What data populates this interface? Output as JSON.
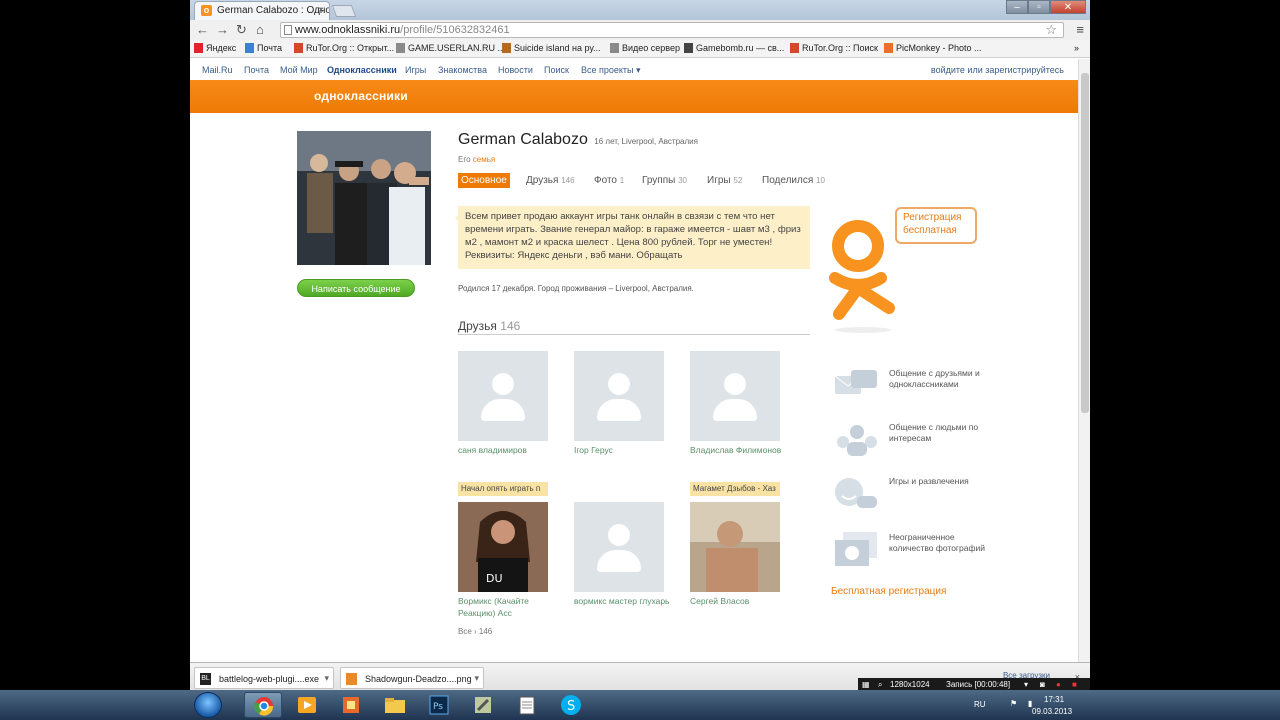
{
  "browser": {
    "tab_title": "German Calabozo : Одно",
    "url_host": "www.odnoklassniki.ru",
    "url_path": "/profile/510632832461",
    "bookmarks": [
      {
        "label": "Яндекс",
        "color": "#e0242b"
      },
      {
        "label": "Почта",
        "color": "#3f7fcf"
      },
      {
        "label": "RuTor.Org :: Открыт...",
        "color": "#d9452a"
      },
      {
        "label": "GAME.USERLAN.RU ...",
        "color": "#8a8a8a"
      },
      {
        "label": "Suicide island на ру...",
        "color": "#b66a1c"
      },
      {
        "label": "Видео сервер",
        "color": "#8a8a8a"
      },
      {
        "label": "Gamebomb.ru — св...",
        "color": "#444444"
      },
      {
        "label": "RuTor.Org :: Поиск",
        "color": "#d9452a"
      },
      {
        "label": "PicMonkey - Photo ...",
        "color": "#e8702a"
      }
    ],
    "bookmarks_more": "»"
  },
  "topnav": {
    "items": [
      "Mail.Ru",
      "Почта",
      "Мой Мир",
      "Одноклассники",
      "Игры",
      "Знакомства",
      "Новости",
      "Поиск",
      "Все проекты ▾"
    ],
    "active_index": 3,
    "login": "войдите или зарегистрируйтесь"
  },
  "site": {
    "logo": "одноклассники",
    "accent": "#ee7a05"
  },
  "profile": {
    "name": "German Calabozo",
    "meta": "16 лет, Liverpool, Австралия",
    "family_prefix": "Его",
    "family_link": "семья",
    "message_button": "Написать сообщение",
    "tabs": [
      {
        "label": "Основное",
        "count": ""
      },
      {
        "label": "Друзья",
        "count": "146"
      },
      {
        "label": "Фото",
        "count": "1"
      },
      {
        "label": "Группы",
        "count": "30"
      },
      {
        "label": "Игры",
        "count": "52"
      },
      {
        "label": "Поделился",
        "count": "10"
      }
    ],
    "status": "Всем привет продаю аккаунт игры танк онлайн в свзязи с тем что нет времени играть. Звание генерал майор: в гараже имеется - шавт м3 , фриз м2 , мамонт м2 и краска шелест . Цена 800 рублей. Торг не уместен! Реквизиты: Яндекс деньги , вэб мани. Обращать",
    "born": "Родился 17 декабря. Город проживания – Liverpool, Австралия."
  },
  "friends": {
    "heading": "Друзья",
    "count": "146",
    "items": [
      {
        "name": "саня владимиров",
        "tag": ""
      },
      {
        "name": "Ігор Герус",
        "tag": ""
      },
      {
        "name": "Владислав Филимонов",
        "tag": ""
      },
      {
        "name": "Вормикс (Качайте Реакцию) Асс",
        "tag": "Начал опять играть п"
      },
      {
        "name": "вормикс мастер глухарь",
        "tag": ""
      },
      {
        "name": "Сергей Власов",
        "tag": "Магамет Дзыбов - Хаз"
      }
    ],
    "all_link": "Все › 146"
  },
  "promo": {
    "bubble": "Регистрация бесплатная",
    "features": [
      {
        "icon": "chat-icon",
        "text": "Общение с друзьями и одноклассниками"
      },
      {
        "icon": "people-icon",
        "text": "Общение с людьми по интересам"
      },
      {
        "icon": "gamepad-icon",
        "text": "Игры и развлечения"
      },
      {
        "icon": "photos-icon",
        "text": "Неограниченное количество фотографий"
      }
    ],
    "free_reg": "Бесплатная регистрация"
  },
  "downloads": [
    {
      "label": "battlelog-web-plugi....exe",
      "icon_text": "BL"
    },
    {
      "label": "Shadowgun-Deadzo....png",
      "icon_text": ""
    }
  ],
  "downloads_tail": "Все загрузки",
  "recorder": {
    "resolution": "1280x1024",
    "rec": "Запись [00:00:48]"
  },
  "tray": {
    "lang": "RU",
    "time": "17:31",
    "date": "09.03.2013"
  }
}
